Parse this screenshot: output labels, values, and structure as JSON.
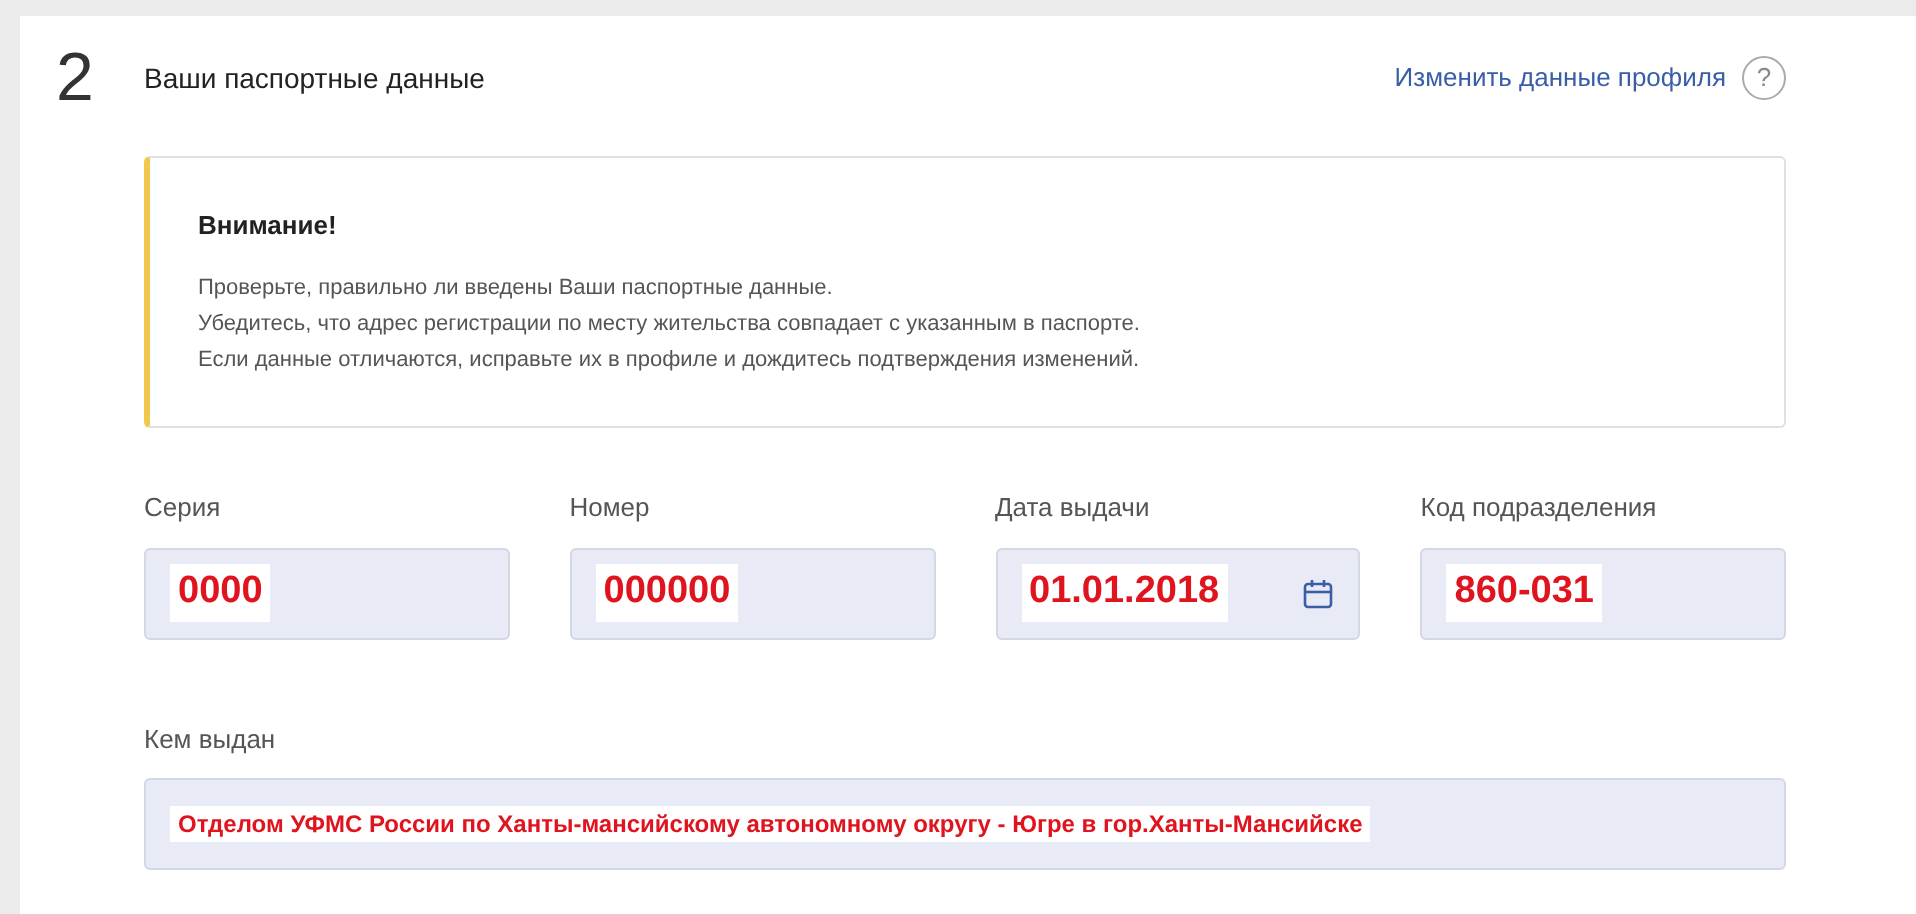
{
  "step": {
    "number": "2",
    "title": "Ваши паспортные данные"
  },
  "profile_link": {
    "label": "Изменить данные профиля",
    "help": "?"
  },
  "notice": {
    "title": "Внимание!",
    "lines": [
      "Проверьте, правильно ли введены Ваши паспортные данные.",
      "Убедитесь, что адрес регистрации по месту жительства совпадает с указанным в паспорте.",
      "Если данные отличаются, исправьте их в профиле и дождитесь подтверждения изменений."
    ]
  },
  "fields": [
    {
      "label": "Серия",
      "value": "0000",
      "kind": "text"
    },
    {
      "label": "Номер",
      "value": "000000",
      "kind": "text"
    },
    {
      "label": "Дата выдачи",
      "value": "01.01.2018",
      "kind": "date"
    },
    {
      "label": "Код подразделения",
      "value": "860-031",
      "kind": "text"
    }
  ],
  "issued_by": {
    "label": "Кем выдан",
    "value": "Отделом УФМС России по Ханты-мансийскому автономному округу - Югре в гор.Ханты-Мансийске"
  }
}
